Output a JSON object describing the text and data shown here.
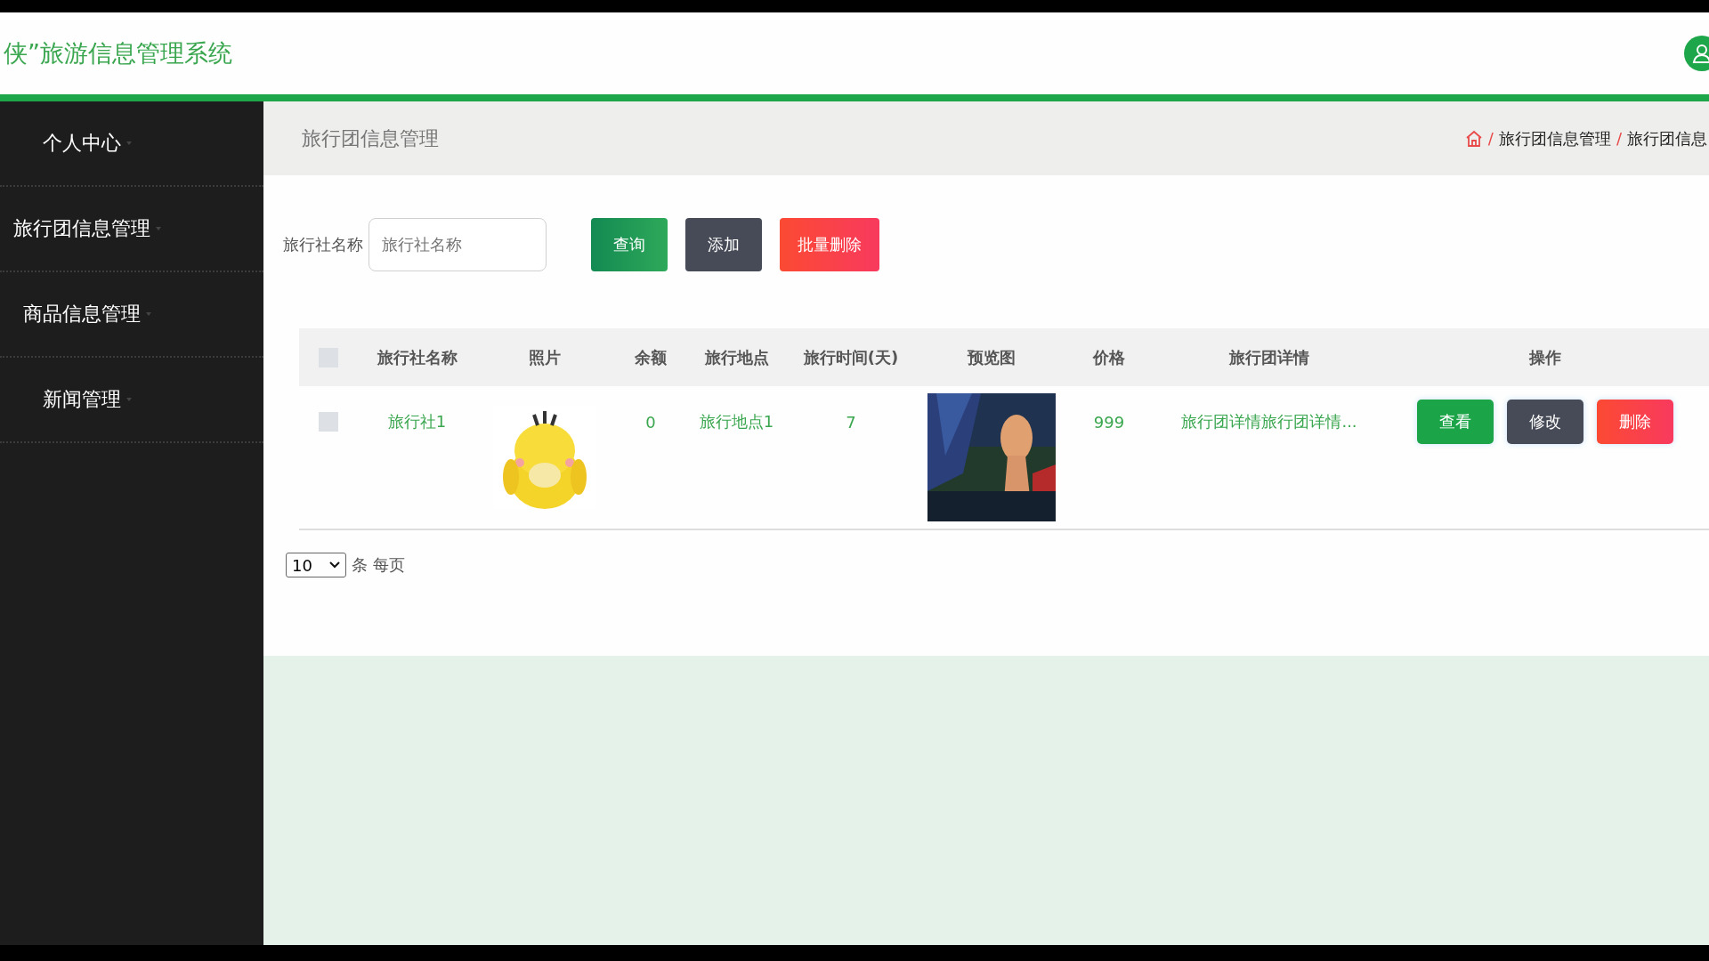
{
  "header": {
    "title": "侠”旅游信息管理系统"
  },
  "sidebar": {
    "items": [
      {
        "label": "个人中心"
      },
      {
        "label": "旅行团信息管理"
      },
      {
        "label": "商品信息管理"
      },
      {
        "label": "新闻管理"
      }
    ]
  },
  "page_title": "旅行团信息管理",
  "breadcrumb": {
    "separator": "/",
    "items": [
      "旅行团信息管理",
      "旅行团信息"
    ]
  },
  "search": {
    "label": "旅行社名称",
    "placeholder": "旅行社名称"
  },
  "buttons": [
    {
      "label": "查询",
      "kind": "search"
    },
    {
      "label": "添加",
      "kind": "add"
    },
    {
      "label": "批量删除",
      "kind": "delete"
    }
  ],
  "table": {
    "select_all": {
      "checked": false
    },
    "columns": [
      "旅行社名称",
      "照片",
      "余额",
      "旅行地点",
      "旅行时间(天)",
      "预览图",
      "价格",
      "旅行团详情",
      "操作"
    ],
    "rows": [
      {
        "checked": false,
        "name": "旅行社1",
        "balance": "0",
        "place": "旅行地点1",
        "days": "7",
        "price": "999",
        "details": "旅行团详情旅行团详情...",
        "actions": [
          {
            "label": "查看",
            "kind": "view"
          },
          {
            "label": "修改",
            "kind": "edit"
          },
          {
            "label": "删除",
            "kind": "delete"
          }
        ]
      }
    ]
  },
  "pagination": {
    "page_size": "10",
    "suffix": "条 每页"
  }
}
